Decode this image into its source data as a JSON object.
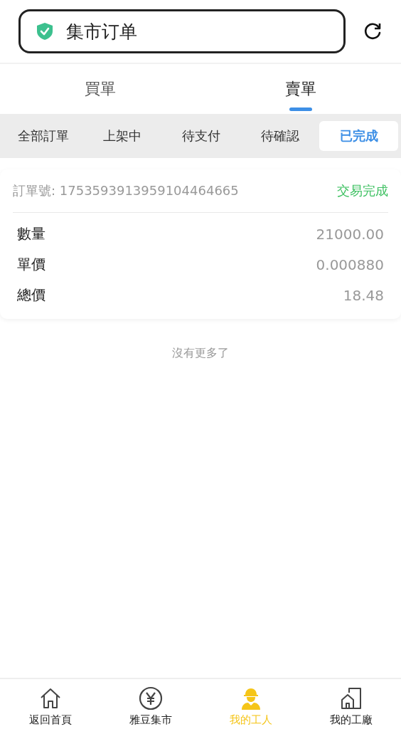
{
  "header": {
    "title": "集市订单"
  },
  "tabs": [
    {
      "label": "買單",
      "selected": false
    },
    {
      "label": "賣單",
      "selected": true
    }
  ],
  "filters": [
    {
      "label": "全部訂單",
      "selected": false
    },
    {
      "label": "上架中",
      "selected": false
    },
    {
      "label": "待支付",
      "selected": false
    },
    {
      "label": "待確認",
      "selected": false
    },
    {
      "label": "已完成",
      "selected": true
    }
  ],
  "orders": [
    {
      "order_no": "訂單號: 1753593913959104464665",
      "status": "交易完成",
      "fields": [
        {
          "label": "數量",
          "value": "21000.00"
        },
        {
          "label": "單價",
          "value": "0.000880"
        },
        {
          "label": "總價",
          "value": "18.48"
        }
      ]
    }
  ],
  "end_text": "沒有更多了",
  "nav": [
    {
      "kind": "home",
      "label": "返回首頁",
      "selected": false
    },
    {
      "kind": "yen",
      "label": "雅豆集市",
      "selected": false
    },
    {
      "kind": "worker",
      "label": "我的工人",
      "selected": true
    },
    {
      "kind": "factory",
      "label": "我的工廠",
      "selected": false
    }
  ]
}
